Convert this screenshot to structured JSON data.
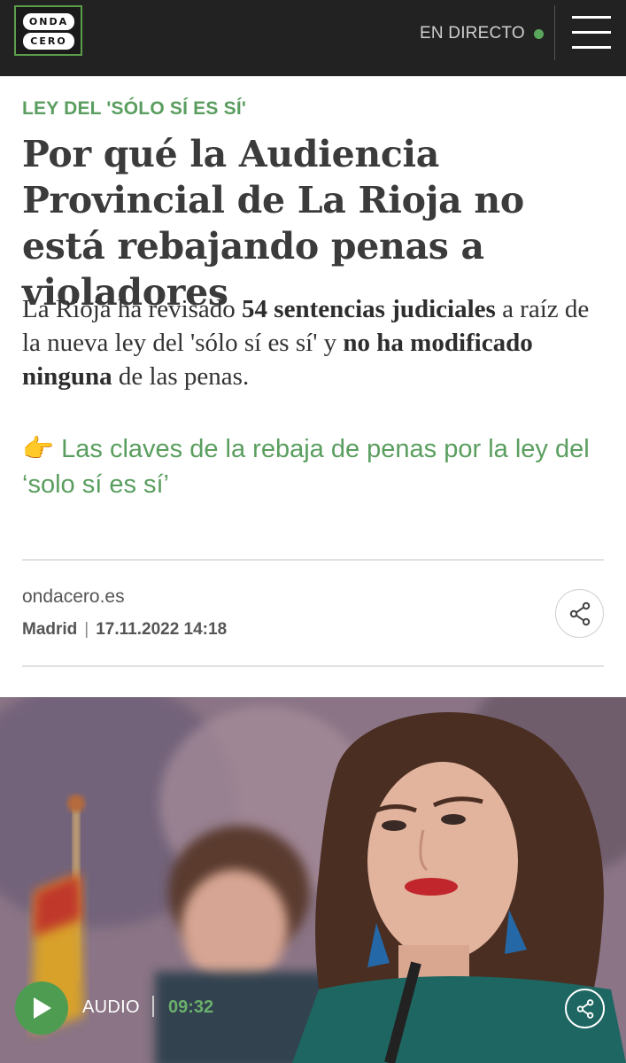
{
  "header": {
    "logo_line1": "ONDA",
    "logo_line2": "CERO",
    "live_label": "EN DIRECTO",
    "live_dot_color": "#5aa65c",
    "menu_icon": "hamburger-menu-icon"
  },
  "article": {
    "kicker": "LEY DEL 'SÓLO SÍ ES SÍ'",
    "title": "Por qué la Audiencia Provincial de La Rioja no está rebajando penas a violadores",
    "subtitle": {
      "part1": "La Rioja ha revisado ",
      "bold1": "54 sentencias judiciales",
      "part2": " a raíz de la nueva ley del 'sólo sí es sí' y ",
      "bold2": "no ha modificado ninguna",
      "part3": " de las penas."
    },
    "related_emoji": "👉",
    "related_link": "Las claves de la rebaja de penas por la ley del ‘solo sí es sí’",
    "source": "ondacero.es",
    "location": "Madrid",
    "datetime": "17.11.2022 14:18",
    "share_icon": "share-icon"
  },
  "audio": {
    "label": "AUDIO",
    "duration": "09:32",
    "play_icon": "play-icon",
    "accent_color": "#4e9c52"
  }
}
